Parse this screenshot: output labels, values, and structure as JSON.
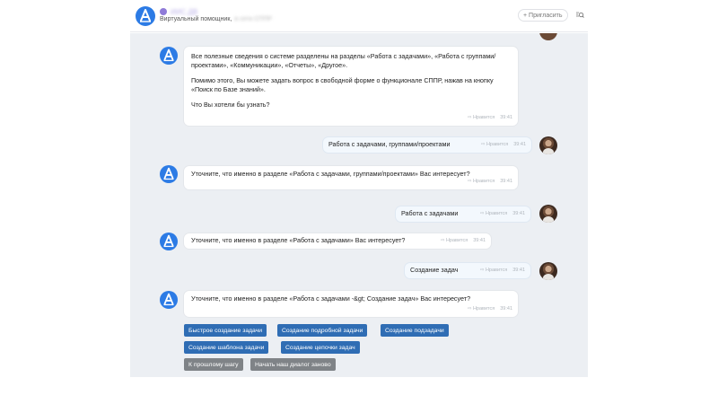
{
  "header": {
    "bot_name": "ИИС.ДВ",
    "subtitle": "Виртуальный помощник,",
    "subtitle_hidden": "в сети СППР",
    "invite_label": "+ Пригласить",
    "search_icon": "search-icon"
  },
  "messages": [
    {
      "sender": "bot",
      "paragraphs": [
        "Все полезные сведения о системе разделены на разделы «Работа с задачами», «Работа с группами/проектами», «Коммуникации», «Отчеты», «Другое».",
        "Помимо этого, Вы можете задать вопрос в свободной форме о функционале СППР, нажав на кнопку «Поиск по Базе знаний».",
        "Что Вы хотели бы узнать?"
      ],
      "like": "Нравится",
      "time": "39:41"
    },
    {
      "sender": "user",
      "text": "Работа с задачами, группами/проектами",
      "like": "Нравится",
      "time": "39:41"
    },
    {
      "sender": "bot",
      "text": "Уточните, что именно в разделе «Работа с задачами, группами/проектами» Вас интересует?",
      "like": "Нравится",
      "time": "39:41"
    },
    {
      "sender": "user",
      "text": "Работа с задачами",
      "like": "Нравится",
      "time": "39:41"
    },
    {
      "sender": "bot",
      "text": "Уточните, что именно в разделе «Работа с задачами» Вас интересует?",
      "like": "Нравится",
      "time": "39:41"
    },
    {
      "sender": "user",
      "text": "Создание задач",
      "like": "Нравится",
      "time": "39:41"
    },
    {
      "sender": "bot",
      "text": "Уточните, что именно в разделе «Работа с задачами -&gt; Создание задач» Вас интересует?",
      "like": "Нравится",
      "time": "39:41"
    }
  ],
  "quick_replies": {
    "row1": [
      "Быстрое создание задачи",
      "Создание подробной задачи",
      "Создание подзадачи"
    ],
    "row2": [
      "Создание шаблона задачи",
      "Создание цепочки задач"
    ],
    "row3": [
      "К прошлому шагу",
      "Начать наш диалог заново"
    ]
  },
  "colors": {
    "accent": "#2f6db4",
    "secondary": "#7f8387",
    "chat_bg": "#eceff3"
  }
}
